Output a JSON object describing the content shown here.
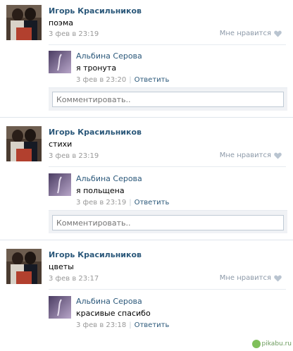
{
  "posts": [
    {
      "author": "Игорь Красильников",
      "text": "поэма",
      "date": "3 фев в 23:19",
      "like_label": "Мне нравится",
      "comment": {
        "author": "Альбина Серова",
        "text": "я тронута",
        "date": "3 фев в 23:20",
        "separator": "|",
        "reply_label": "Ответить"
      },
      "comment_placeholder": "Комментировать.."
    },
    {
      "author": "Игорь Красильников",
      "text": "стихи",
      "date": "3 фев в 23:19",
      "like_label": "Мне нравится",
      "comment": {
        "author": "Альбина Серова",
        "text": "я польщена",
        "date": "3 фев в 23:19",
        "separator": "|",
        "reply_label": "Ответить"
      },
      "comment_placeholder": "Комментировать.."
    },
    {
      "author": "Игорь Красильников",
      "text": "цветы",
      "date": "3 фев в 23:17",
      "like_label": "Мне нравится",
      "comment": {
        "author": "Альбина Серова",
        "text": "красивые спасибо",
        "date": "3 фев в 23:18",
        "separator": "|",
        "reply_label": "Ответить"
      }
    }
  ],
  "watermark": "pikabu.ru",
  "colors": {
    "link": "#2b587a",
    "date": "#999999",
    "like": "#8c99a8",
    "separator": "#e7ebf0",
    "input_border": "#c0cad5"
  },
  "icons": {
    "like": "heart-icon"
  }
}
